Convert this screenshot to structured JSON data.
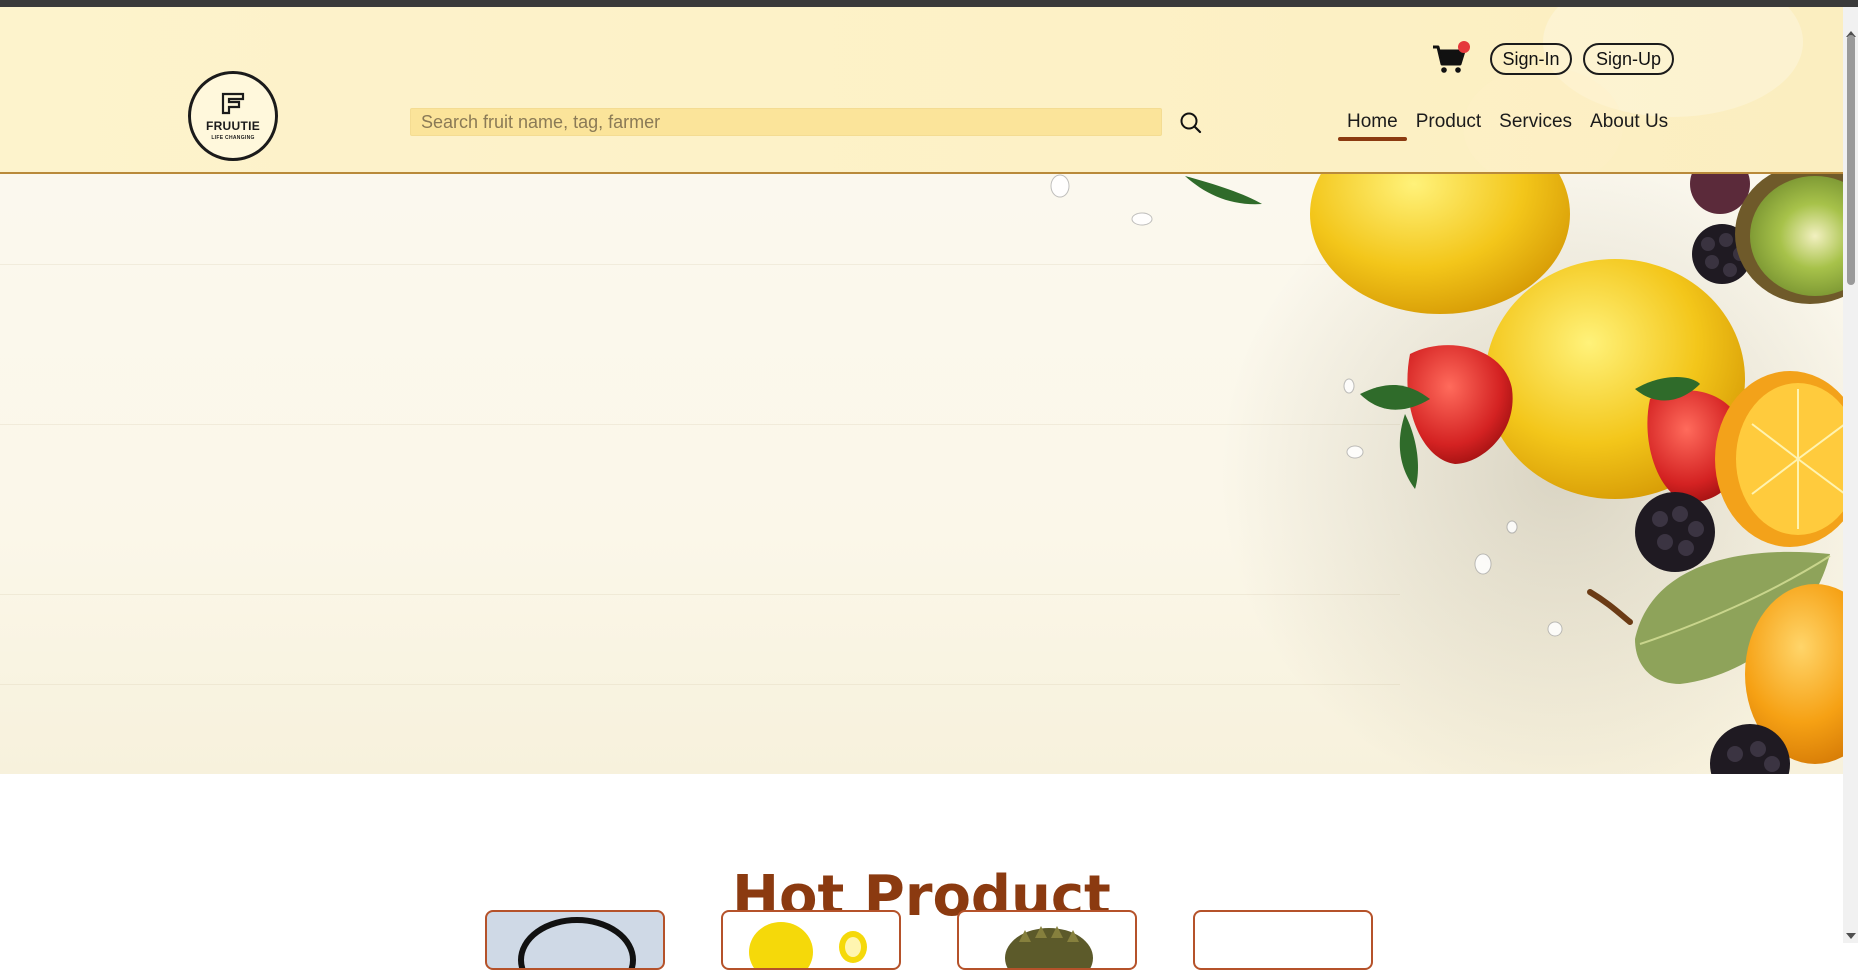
{
  "logo": {
    "name": "FRUUTIE",
    "tagline": "LIFE CHANGING"
  },
  "search": {
    "placeholder": "Search fruit name, tag, farmer",
    "value": ""
  },
  "header": {
    "signin_label": "Sign-In",
    "signup_label": "Sign-Up",
    "cart_icon": "cart-icon",
    "search_icon": "search-icon"
  },
  "nav": {
    "items": [
      {
        "label": "Home",
        "active": true
      },
      {
        "label": "Product",
        "active": false
      },
      {
        "label": "Services",
        "active": false
      },
      {
        "label": "About Us",
        "active": false
      }
    ]
  },
  "hot_product": {
    "title": "Hot Product"
  },
  "colors": {
    "header_bg": "#fdf3cc",
    "search_bg": "#fbe49a",
    "accent": "#8b3a10",
    "badge": "#e5383b"
  }
}
